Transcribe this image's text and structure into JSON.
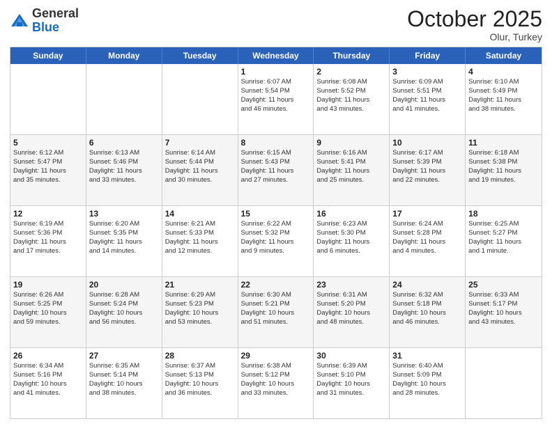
{
  "header": {
    "logo_general": "General",
    "logo_blue": "Blue",
    "month_title": "October 2025",
    "location": "Olur, Turkey"
  },
  "days_of_week": [
    "Sunday",
    "Monday",
    "Tuesday",
    "Wednesday",
    "Thursday",
    "Friday",
    "Saturday"
  ],
  "rows": [
    {
      "alt": false,
      "cells": [
        {
          "day": "",
          "lines": []
        },
        {
          "day": "",
          "lines": []
        },
        {
          "day": "",
          "lines": []
        },
        {
          "day": "1",
          "lines": [
            "Sunrise: 6:07 AM",
            "Sunset: 5:54 PM",
            "Daylight: 11 hours",
            "and 46 minutes."
          ]
        },
        {
          "day": "2",
          "lines": [
            "Sunrise: 6:08 AM",
            "Sunset: 5:52 PM",
            "Daylight: 11 hours",
            "and 43 minutes."
          ]
        },
        {
          "day": "3",
          "lines": [
            "Sunrise: 6:09 AM",
            "Sunset: 5:51 PM",
            "Daylight: 11 hours",
            "and 41 minutes."
          ]
        },
        {
          "day": "4",
          "lines": [
            "Sunrise: 6:10 AM",
            "Sunset: 5:49 PM",
            "Daylight: 11 hours",
            "and 38 minutes."
          ]
        }
      ]
    },
    {
      "alt": true,
      "cells": [
        {
          "day": "5",
          "lines": [
            "Sunrise: 6:12 AM",
            "Sunset: 5:47 PM",
            "Daylight: 11 hours",
            "and 35 minutes."
          ]
        },
        {
          "day": "6",
          "lines": [
            "Sunrise: 6:13 AM",
            "Sunset: 5:46 PM",
            "Daylight: 11 hours",
            "and 33 minutes."
          ]
        },
        {
          "day": "7",
          "lines": [
            "Sunrise: 6:14 AM",
            "Sunset: 5:44 PM",
            "Daylight: 11 hours",
            "and 30 minutes."
          ]
        },
        {
          "day": "8",
          "lines": [
            "Sunrise: 6:15 AM",
            "Sunset: 5:43 PM",
            "Daylight: 11 hours",
            "and 27 minutes."
          ]
        },
        {
          "day": "9",
          "lines": [
            "Sunrise: 6:16 AM",
            "Sunset: 5:41 PM",
            "Daylight: 11 hours",
            "and 25 minutes."
          ]
        },
        {
          "day": "10",
          "lines": [
            "Sunrise: 6:17 AM",
            "Sunset: 5:39 PM",
            "Daylight: 11 hours",
            "and 22 minutes."
          ]
        },
        {
          "day": "11",
          "lines": [
            "Sunrise: 6:18 AM",
            "Sunset: 5:38 PM",
            "Daylight: 11 hours",
            "and 19 minutes."
          ]
        }
      ]
    },
    {
      "alt": false,
      "cells": [
        {
          "day": "12",
          "lines": [
            "Sunrise: 6:19 AM",
            "Sunset: 5:36 PM",
            "Daylight: 11 hours",
            "and 17 minutes."
          ]
        },
        {
          "day": "13",
          "lines": [
            "Sunrise: 6:20 AM",
            "Sunset: 5:35 PM",
            "Daylight: 11 hours",
            "and 14 minutes."
          ]
        },
        {
          "day": "14",
          "lines": [
            "Sunrise: 6:21 AM",
            "Sunset: 5:33 PM",
            "Daylight: 11 hours",
            "and 12 minutes."
          ]
        },
        {
          "day": "15",
          "lines": [
            "Sunrise: 6:22 AM",
            "Sunset: 5:32 PM",
            "Daylight: 11 hours",
            "and 9 minutes."
          ]
        },
        {
          "day": "16",
          "lines": [
            "Sunrise: 6:23 AM",
            "Sunset: 5:30 PM",
            "Daylight: 11 hours",
            "and 6 minutes."
          ]
        },
        {
          "day": "17",
          "lines": [
            "Sunrise: 6:24 AM",
            "Sunset: 5:28 PM",
            "Daylight: 11 hours",
            "and 4 minutes."
          ]
        },
        {
          "day": "18",
          "lines": [
            "Sunrise: 6:25 AM",
            "Sunset: 5:27 PM",
            "Daylight: 11 hours",
            "and 1 minute."
          ]
        }
      ]
    },
    {
      "alt": true,
      "cells": [
        {
          "day": "19",
          "lines": [
            "Sunrise: 6:26 AM",
            "Sunset: 5:25 PM",
            "Daylight: 10 hours",
            "and 59 minutes."
          ]
        },
        {
          "day": "20",
          "lines": [
            "Sunrise: 6:28 AM",
            "Sunset: 5:24 PM",
            "Daylight: 10 hours",
            "and 56 minutes."
          ]
        },
        {
          "day": "21",
          "lines": [
            "Sunrise: 6:29 AM",
            "Sunset: 5:23 PM",
            "Daylight: 10 hours",
            "and 53 minutes."
          ]
        },
        {
          "day": "22",
          "lines": [
            "Sunrise: 6:30 AM",
            "Sunset: 5:21 PM",
            "Daylight: 10 hours",
            "and 51 minutes."
          ]
        },
        {
          "day": "23",
          "lines": [
            "Sunrise: 6:31 AM",
            "Sunset: 5:20 PM",
            "Daylight: 10 hours",
            "and 48 minutes."
          ]
        },
        {
          "day": "24",
          "lines": [
            "Sunrise: 6:32 AM",
            "Sunset: 5:18 PM",
            "Daylight: 10 hours",
            "and 46 minutes."
          ]
        },
        {
          "day": "25",
          "lines": [
            "Sunrise: 6:33 AM",
            "Sunset: 5:17 PM",
            "Daylight: 10 hours",
            "and 43 minutes."
          ]
        }
      ]
    },
    {
      "alt": false,
      "cells": [
        {
          "day": "26",
          "lines": [
            "Sunrise: 6:34 AM",
            "Sunset: 5:16 PM",
            "Daylight: 10 hours",
            "and 41 minutes."
          ]
        },
        {
          "day": "27",
          "lines": [
            "Sunrise: 6:35 AM",
            "Sunset: 5:14 PM",
            "Daylight: 10 hours",
            "and 38 minutes."
          ]
        },
        {
          "day": "28",
          "lines": [
            "Sunrise: 6:37 AM",
            "Sunset: 5:13 PM",
            "Daylight: 10 hours",
            "and 36 minutes."
          ]
        },
        {
          "day": "29",
          "lines": [
            "Sunrise: 6:38 AM",
            "Sunset: 5:12 PM",
            "Daylight: 10 hours",
            "and 33 minutes."
          ]
        },
        {
          "day": "30",
          "lines": [
            "Sunrise: 6:39 AM",
            "Sunset: 5:10 PM",
            "Daylight: 10 hours",
            "and 31 minutes."
          ]
        },
        {
          "day": "31",
          "lines": [
            "Sunrise: 6:40 AM",
            "Sunset: 5:09 PM",
            "Daylight: 10 hours",
            "and 28 minutes."
          ]
        },
        {
          "day": "",
          "lines": []
        }
      ]
    }
  ]
}
